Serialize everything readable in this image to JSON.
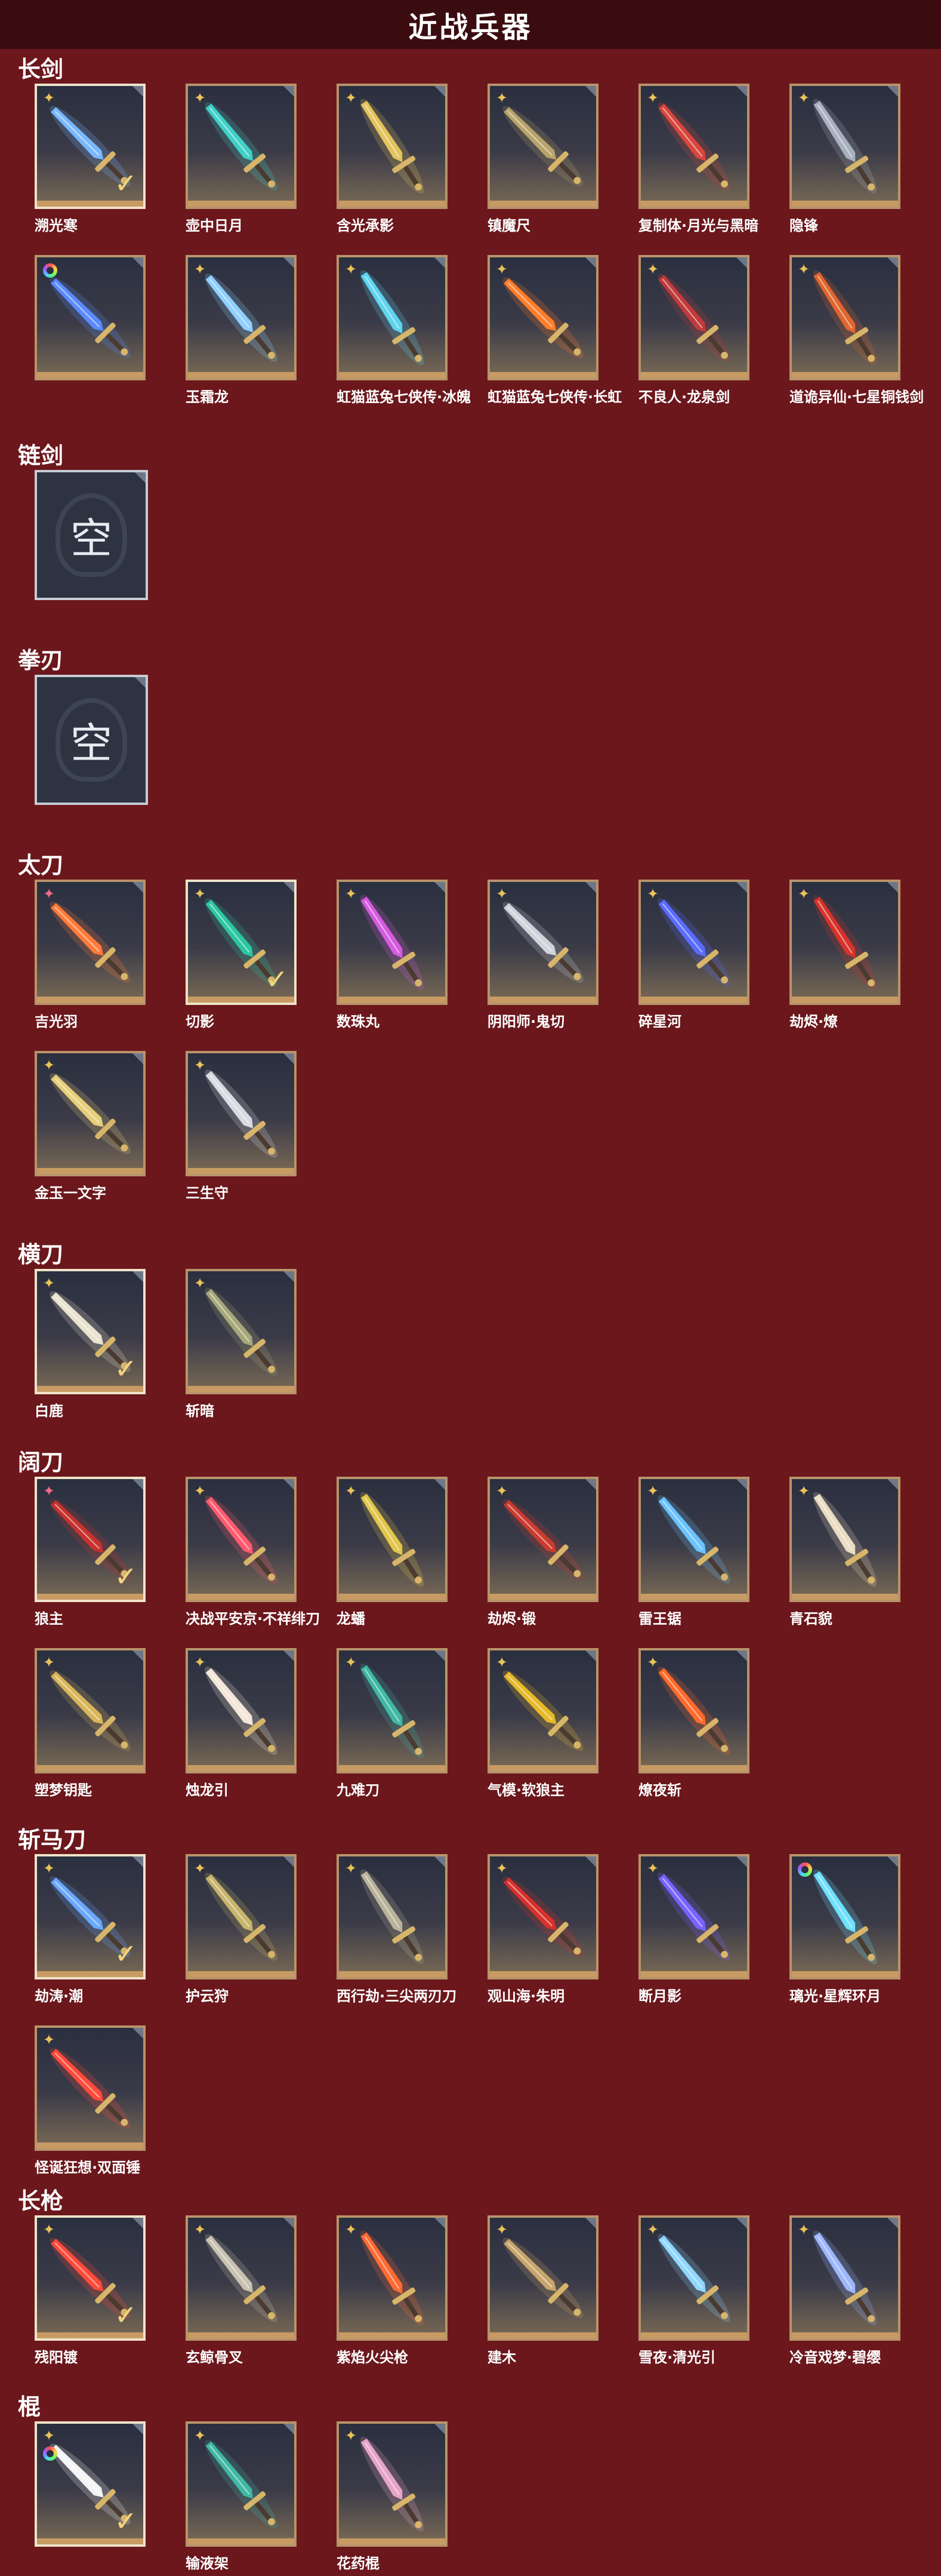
{
  "title": "近战兵器",
  "empty_label": "空",
  "checkmark": "✓",
  "sections": [
    {
      "name": "长剑",
      "items": [
        {
          "name": "溯光寒",
          "rank": "gold",
          "owned": true,
          "color": "#79b8ff"
        },
        {
          "name": "壶中日月",
          "rank": "gold",
          "owned": false,
          "color": "#3fd1c7"
        },
        {
          "name": "含光承影",
          "rank": "gold",
          "owned": false,
          "color": "#e3c35c"
        },
        {
          "name": "镇魔尺",
          "rank": "gold",
          "owned": false,
          "color": "#b8a36a"
        },
        {
          "name": "复制体·月光与黑暗",
          "rank": "gold",
          "owned": false,
          "color": "#d9463d"
        },
        {
          "name": "隐锋",
          "rank": "gold",
          "owned": false,
          "color": "#a9b0bf"
        },
        {
          "name": "",
          "rank": "rainbow",
          "owned": false,
          "color": "#5b8bff"
        },
        {
          "name": "玉霜龙",
          "rank": "gold",
          "owned": false,
          "color": "#8fd0ff"
        },
        {
          "name": "虹猫蓝兔七侠传·冰魄",
          "rank": "gold",
          "owned": false,
          "color": "#5fd4f0"
        },
        {
          "name": "虹猫蓝兔七侠传·长虹",
          "rank": "gold",
          "owned": false,
          "color": "#ff7d2a"
        },
        {
          "name": "不良人·龙泉剑",
          "rank": "gold",
          "owned": false,
          "color": "#c23a3a"
        },
        {
          "name": "道诡异仙·七星铜钱剑",
          "rank": "gold",
          "owned": false,
          "color": "#e0662e"
        }
      ]
    },
    {
      "name": "链剑",
      "items": [],
      "empty": true
    },
    {
      "name": "拳刃",
      "items": [],
      "empty": true
    },
    {
      "name": "太刀",
      "items": [
        {
          "name": "吉光羽",
          "rank": "pink",
          "owned": false,
          "color": "#ff7a3a"
        },
        {
          "name": "切影",
          "rank": "gold",
          "owned": true,
          "color": "#2cc7a2"
        },
        {
          "name": "数珠丸",
          "rank": "gold",
          "owned": false,
          "color": "#d65be0"
        },
        {
          "name": "阴阳师·鬼切",
          "rank": "gold",
          "owned": false,
          "color": "#cfd3da"
        },
        {
          "name": "碎星河",
          "rank": "gold",
          "owned": false,
          "color": "#5a6cff"
        },
        {
          "name": "劫烬·燎",
          "rank": "gold",
          "owned": false,
          "color": "#d8322b"
        },
        {
          "name": "金玉一文字",
          "rank": "gold",
          "owned": false,
          "color": "#e6cf7a"
        },
        {
          "name": "三生守",
          "rank": "gold",
          "owned": false,
          "color": "#d9dbe2"
        }
      ]
    },
    {
      "name": "横刀",
      "items": [
        {
          "name": "白鹿",
          "rank": "gold",
          "owned": true,
          "color": "#e8e2cf"
        },
        {
          "name": "斩暗",
          "rank": "gold",
          "owned": false,
          "color": "#a7a87a"
        }
      ]
    },
    {
      "name": "阔刀",
      "items": [
        {
          "name": "狼主",
          "rank": "pink",
          "owned": true,
          "color": "#c7322d"
        },
        {
          "name": "决战平安京·不祥绯刀",
          "rank": "gold",
          "owned": false,
          "color": "#ff5a6e"
        },
        {
          "name": "龙蟠",
          "rank": "gold",
          "owned": false,
          "color": "#e2c64b"
        },
        {
          "name": "劫烬·锻",
          "rank": "gold",
          "owned": false,
          "color": "#cc3a2e"
        },
        {
          "name": "雷王锯",
          "rank": "gold",
          "owned": false,
          "color": "#6ac3ff"
        },
        {
          "name": "青石貌",
          "rank": "gold",
          "owned": false,
          "color": "#e9dcc3"
        },
        {
          "name": "塑梦钥匙",
          "rank": "gold",
          "owned": false,
          "color": "#d9b65a"
        },
        {
          "name": "烛龙引",
          "rank": "gold",
          "owned": false,
          "color": "#f1e6d8"
        },
        {
          "name": "九难刀",
          "rank": "gold",
          "owned": false,
          "color": "#3fb8a4"
        },
        {
          "name": "气模·软狼主",
          "rank": "gold",
          "owned": false,
          "color": "#e6b928"
        },
        {
          "name": "燎夜斩",
          "rank": "gold",
          "owned": false,
          "color": "#ff6a2a"
        }
      ]
    },
    {
      "name": "斩马刀",
      "items": [
        {
          "name": "劫涛·潮",
          "rank": "gold",
          "owned": true,
          "color": "#6aa8ff"
        },
        {
          "name": "护云狩",
          "rank": "gold",
          "owned": false,
          "color": "#c8b46b"
        },
        {
          "name": "西行劫·三尖两刃刀",
          "rank": "gold",
          "owned": false,
          "color": "#b9b39a"
        },
        {
          "name": "观山海·朱明",
          "rank": "gold",
          "owned": false,
          "color": "#d8302a"
        },
        {
          "name": "断月影",
          "rank": "gold",
          "owned": false,
          "color": "#7a62ff"
        },
        {
          "name": "璃光·星辉环月",
          "rank": "rainbow",
          "owned": false,
          "color": "#6fe0ff"
        },
        {
          "name": "怪诞狂想·双面锤",
          "rank": "gold",
          "owned": false,
          "color": "#ff4b3a"
        }
      ]
    },
    {
      "name": "长枪",
      "items": [
        {
          "name": "残阳镀",
          "rank": "gold",
          "owned": true,
          "color": "#ff4a3a"
        },
        {
          "name": "玄鲸骨叉",
          "rank": "gold",
          "owned": false,
          "color": "#c9c2b0"
        },
        {
          "name": "紫焰火尖枪",
          "rank": "gold",
          "owned": false,
          "color": "#ff6a32"
        },
        {
          "name": "建木",
          "rank": "gold",
          "owned": false,
          "color": "#c8a56a"
        },
        {
          "name": "雪夜·清光引",
          "rank": "gold",
          "owned": false,
          "color": "#8fd7ff"
        },
        {
          "name": "冷音戏梦·碧缨",
          "rank": "gold",
          "owned": false,
          "color": "#9db7ff"
        }
      ]
    },
    {
      "name": "棍",
      "items": [
        {
          "name": "",
          "rank": "gold-rainbow",
          "owned": true,
          "color": "#f4f4f4"
        },
        {
          "name": "输液架",
          "rank": "gold",
          "owned": false,
          "color": "#3fb8a4"
        },
        {
          "name": "花药棍",
          "rank": "gold",
          "owned": false,
          "color": "#e7a3c8"
        }
      ]
    }
  ]
}
